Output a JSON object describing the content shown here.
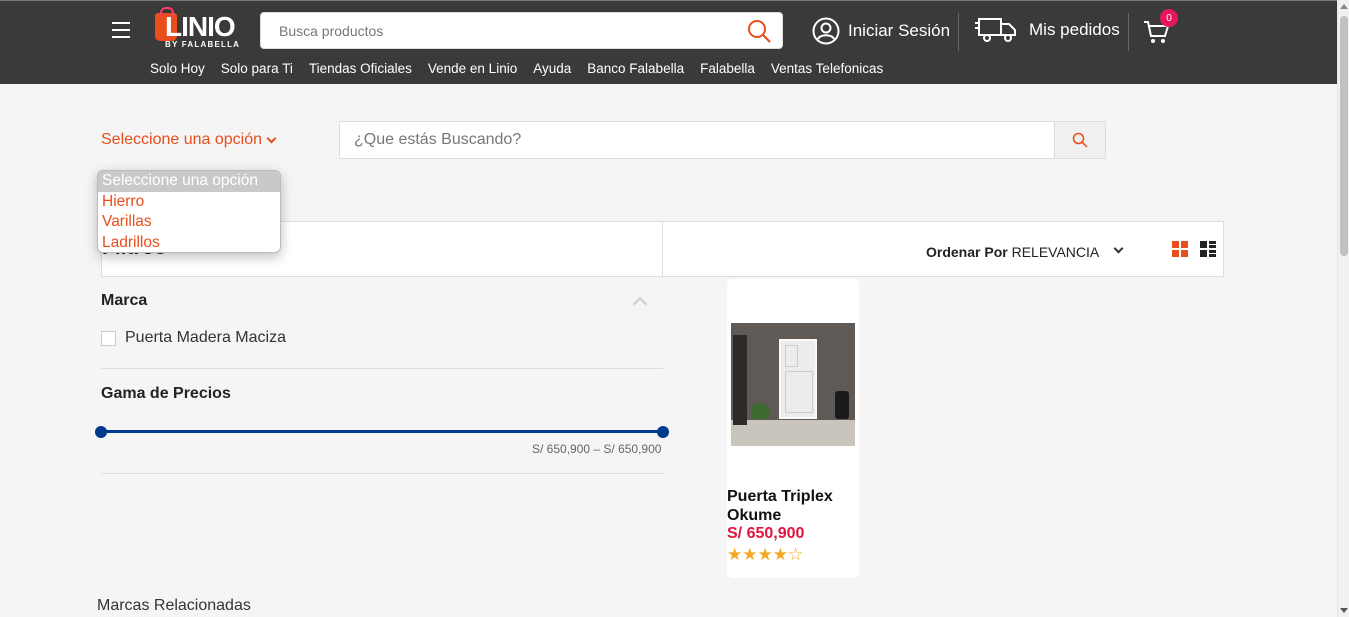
{
  "header": {
    "logo_text": "LINIO",
    "logo_sub": "BY FALABELLA",
    "search_placeholder": "Busca productos",
    "login_label": "Iniciar Sesión",
    "orders_label": "Mis pedidos",
    "cart_count": "0",
    "nav": [
      "Solo Hoy",
      "Solo para Ti",
      "Tiendas Oficiales",
      "Vende en Linio",
      "Ayuda",
      "Banco Falabella",
      "Falabella",
      "Ventas Telefonicas"
    ]
  },
  "category_select": {
    "label": "Seleccione una opción",
    "options": [
      "Seleccione una opción",
      "Hierro",
      "Varillas",
      "Ladrillos"
    ]
  },
  "main_search": {
    "placeholder": "¿Que estás Buscando?"
  },
  "filters": {
    "title": "Filtros",
    "brand_title": "Marca",
    "brand_options": [
      "Puerta Madera Maciza"
    ],
    "price_title": "Gama de Precios",
    "price_range": "S/ 650,900 – S/ 650,900"
  },
  "sort": {
    "label": "Ordenar Por",
    "value": "RELEVANCIA"
  },
  "products": [
    {
      "name": "Puerta Triplex Okume",
      "price": "S/ 650,900",
      "rating": 4,
      "stars": "★★★★☆"
    }
  ],
  "related_brands_label": "Marcas Relacionadas",
  "colors": {
    "accent": "#e84e1c",
    "header_bg": "#3a3a3a",
    "price": "#e0153f",
    "slider": "#003a8c",
    "badge": "#e8175d"
  }
}
